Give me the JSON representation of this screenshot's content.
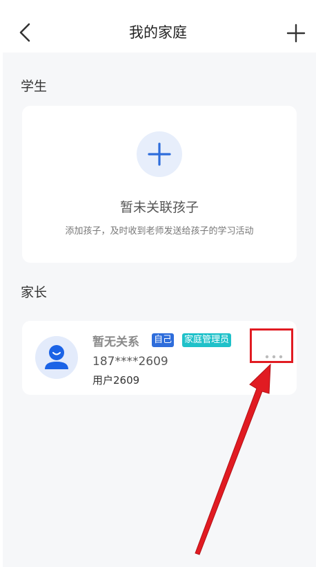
{
  "header": {
    "title": "我的家庭",
    "back_icon": "chevron-left-icon",
    "add_icon": "plus-icon"
  },
  "students": {
    "section_label": "学生",
    "empty_title": "暂未关联孩子",
    "empty_description": "添加孩子，及时收到老师发送给孩子的学习活动",
    "add_icon": "plus-icon"
  },
  "parents": {
    "section_label": "家长",
    "member": {
      "relation": "暂无关系",
      "badge_self": "自己",
      "badge_admin": "家庭管理员",
      "phone": "187****2609",
      "username": "用户2609",
      "more_icon": "more-dots-icon"
    }
  },
  "colors": {
    "accent": "#2e6ddb",
    "admin_badge": "#1fc1c9",
    "highlight": "#e11b22"
  }
}
